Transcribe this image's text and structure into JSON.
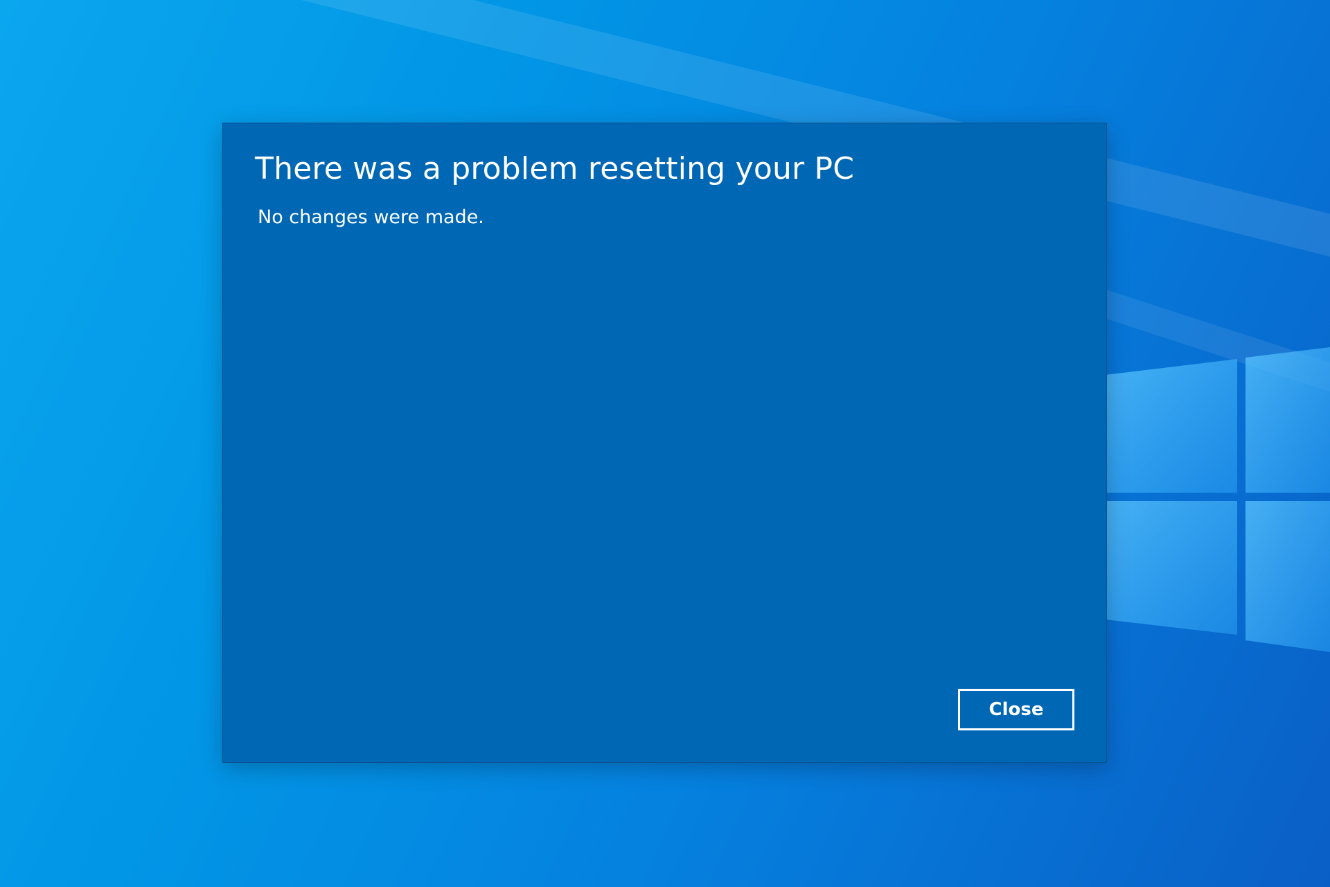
{
  "dialog": {
    "title": "There was a problem resetting your PC",
    "message": "No changes were made.",
    "close_label": "Close"
  },
  "desktop": {
    "wallpaper": "windows-10-hero-wallpaper",
    "logo_icon": "windows-logo-icon"
  },
  "colors": {
    "dialog_background": "#0067b4",
    "desktop_light": "#0aa6ee",
    "desktop_dark": "#0a5fc6",
    "text": "#ffffff"
  }
}
